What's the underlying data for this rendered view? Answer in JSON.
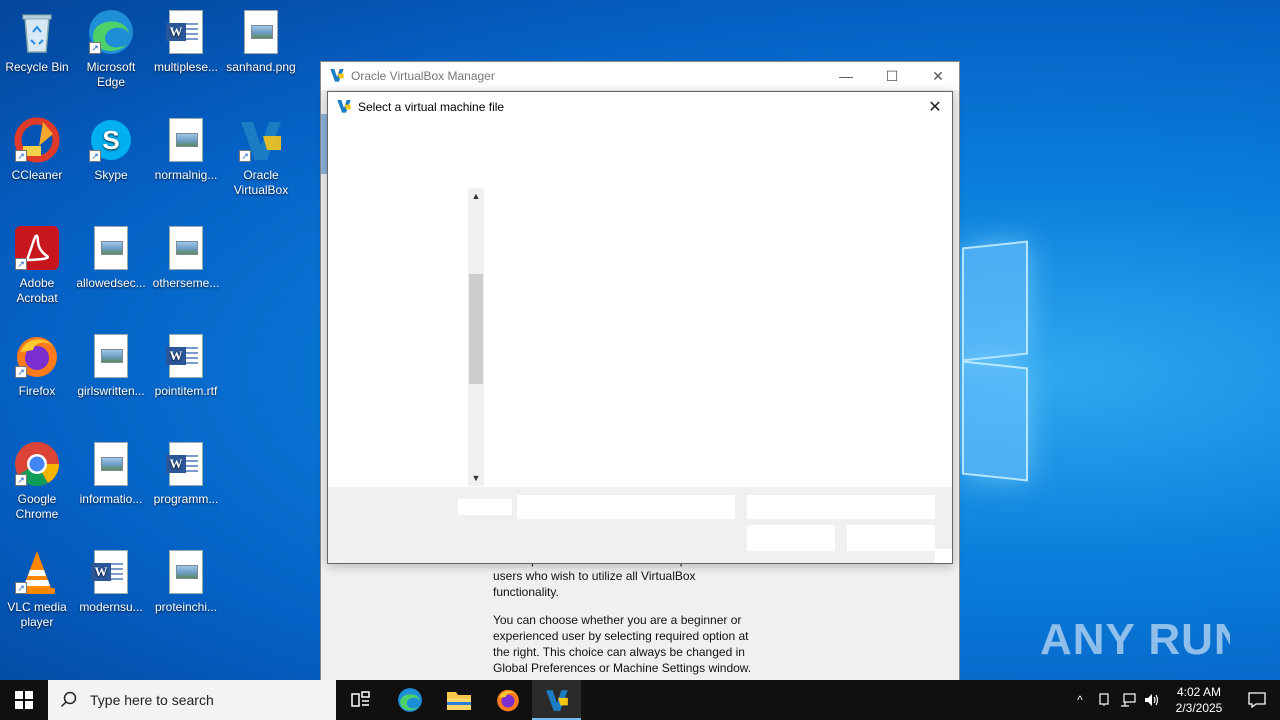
{
  "desktop_icons": [
    {
      "label": "Recycle Bin",
      "icon": "recycle-bin-icon"
    },
    {
      "label": "Microsoft Edge",
      "icon": "edge-icon"
    },
    {
      "label": "multiplese...",
      "icon": "word-doc-icon"
    },
    {
      "label": "sanhand.png",
      "icon": "image-file-icon"
    },
    {
      "label": "CCleaner",
      "icon": "ccleaner-icon"
    },
    {
      "label": "Skype",
      "icon": "skype-icon"
    },
    {
      "label": "normalnig...",
      "icon": "image-file-icon"
    },
    {
      "label": "Oracle VirtualBox",
      "icon": "virtualbox-icon"
    },
    {
      "label": "Adobe Acrobat",
      "icon": "acrobat-icon"
    },
    {
      "label": "allowedsec...",
      "icon": "image-file-icon"
    },
    {
      "label": "otherseme...",
      "icon": "image-file-icon"
    },
    {
      "label": "Firefox",
      "icon": "firefox-icon"
    },
    {
      "label": "girlswritten...",
      "icon": "image-file-icon"
    },
    {
      "label": "pointitem.rtf",
      "icon": "word-doc-icon"
    },
    {
      "label": "Google Chrome",
      "icon": "chrome-icon"
    },
    {
      "label": "informatio...",
      "icon": "image-file-icon"
    },
    {
      "label": "programm...",
      "icon": "word-doc-icon"
    },
    {
      "label": "VLC media player",
      "icon": "vlc-icon"
    },
    {
      "label": "modernsu...",
      "icon": "word-doc-icon"
    },
    {
      "label": "proteinchi...",
      "icon": "image-file-icon"
    }
  ],
  "vbox_window": {
    "title": "Oracle VirtualBox Manager",
    "minimize": "—",
    "maximize": "☐",
    "close": "✕",
    "text": {
      "line1": "The Expert Mode is intended for experienced users who wish to utilize all VirtualBox functionality.",
      "para2": "You can choose whether you are a beginner or experienced user by selecting required option at the right. This choice can always be changed in Global Preferences or Machine Settings window."
    }
  },
  "dialog": {
    "title": "Select a virtual machine file",
    "close": "✕",
    "scroll_up": "▲",
    "scroll_down": "▼"
  },
  "watermark": {
    "text": "ANY RUN"
  },
  "taskbar": {
    "search_placeholder": "Type here to search",
    "time": "4:02 AM",
    "date": "2/3/2025",
    "tray_up": "^"
  },
  "colors": {
    "taskbar": "#101010",
    "accent": "#76b9ed",
    "wallpaper": "#0a7fdb"
  }
}
